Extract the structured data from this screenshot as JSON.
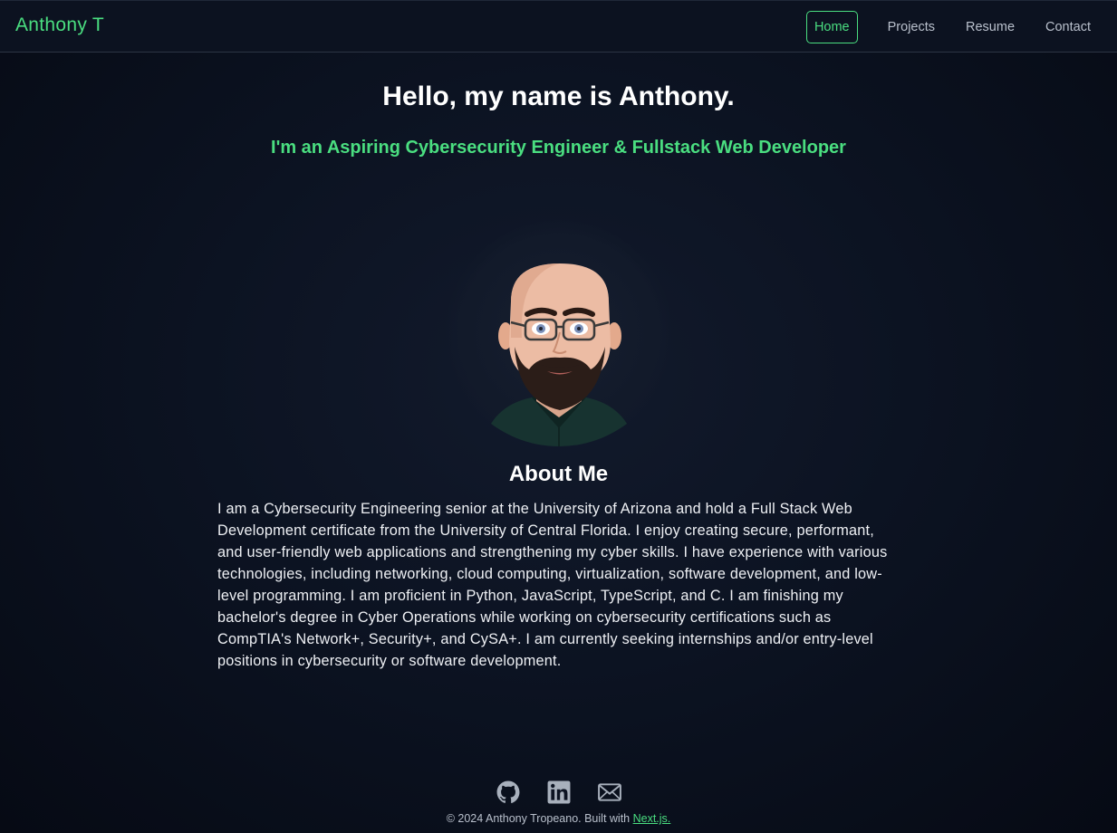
{
  "nav": {
    "brand": "Anthony T",
    "links": [
      {
        "label": "Home",
        "active": true
      },
      {
        "label": "Projects",
        "active": false
      },
      {
        "label": "Resume",
        "active": false
      },
      {
        "label": "Contact",
        "active": false
      }
    ]
  },
  "hero": {
    "title": "Hello, my name is Anthony.",
    "subtitle": "I'm an Aspiring Cybersecurity Engineer & Fullstack Web Developer"
  },
  "about": {
    "title": "About Me",
    "body": "I am a Cybersecurity Engineering senior at the University of Arizona and hold a Full Stack Web Development certificate from the University of Central Florida. I enjoy creating secure, performant, and user-friendly web applications and strengthening my cyber skills. I have experience with various technologies, including networking, cloud computing, virtualization, software development, and low-level programming. I am proficient in Python, JavaScript, TypeScript, and C. I am finishing my bachelor's degree in Cyber Operations while working on cybersecurity certifications such as CompTIA's Network+, Security+, and CySA+. I am currently seeking internships and/or entry-level positions in cybersecurity or software development."
  },
  "footer": {
    "copyright": "© 2024 Anthony Tropeano. Built with ",
    "link_label": "Next.js."
  },
  "social_icons": [
    "github-icon",
    "linkedin-icon",
    "email-icon"
  ],
  "colors": {
    "accent": "#4ade80",
    "background": "#0c1322",
    "text": "#ffffff",
    "muted": "#b9c0cc"
  }
}
